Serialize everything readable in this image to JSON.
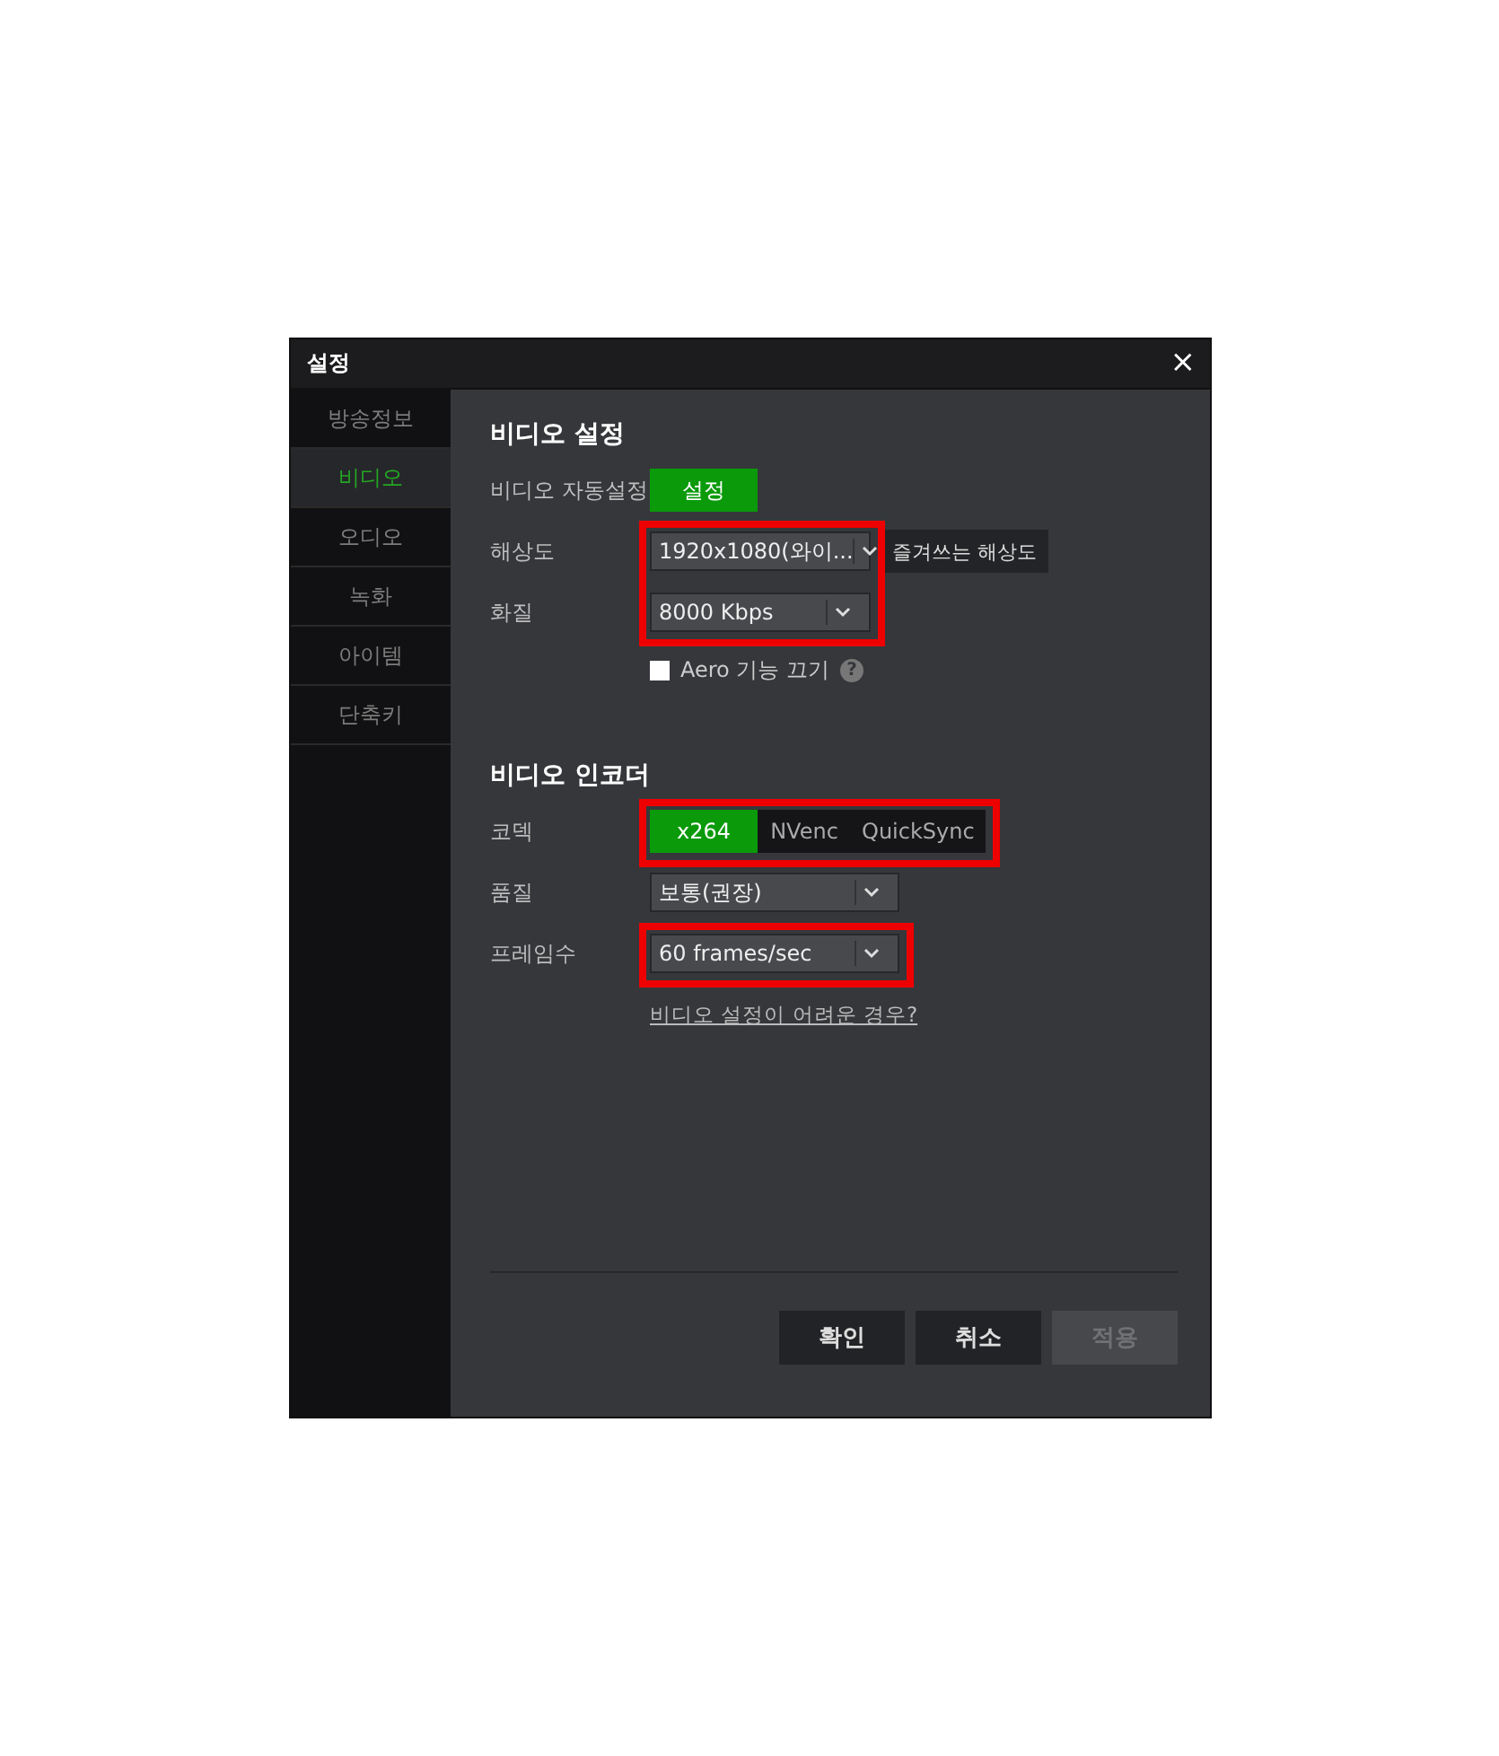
{
  "window": {
    "title": "설정",
    "close": "×"
  },
  "sidebar": {
    "items": [
      {
        "label": "방송정보",
        "selected": false
      },
      {
        "label": "비디오",
        "selected": true
      },
      {
        "label": "오디오",
        "selected": false
      },
      {
        "label": "녹화",
        "selected": false
      },
      {
        "label": "아이템",
        "selected": false
      },
      {
        "label": "단축키",
        "selected": false
      }
    ]
  },
  "sections": [
    {
      "title": "비디오 설정",
      "rows": [
        {
          "kind": "button",
          "label": "비디오 자동설정",
          "button": "설정",
          "highlighted": false
        },
        {
          "kind": "select",
          "label": "해상도",
          "value": "1920x1080(와이...",
          "extra_button": "즐겨쓰는 해상도",
          "wide": false,
          "highlighted": true
        },
        {
          "kind": "select",
          "label": "화질",
          "value": "8000 Kbps",
          "wide": false,
          "highlighted": true
        },
        {
          "kind": "checkbox",
          "label": "Aero 기능 끄기",
          "checked": false,
          "help": "?",
          "highlighted": false
        }
      ]
    },
    {
      "title": "비디오 인코더",
      "rows": [
        {
          "kind": "segmented",
          "label": "코덱",
          "options": [
            {
              "label": "x264",
              "selected": true
            },
            {
              "label": "NVenc",
              "selected": false
            },
            {
              "label": "QuickSync",
              "selected": false
            }
          ],
          "highlighted": true
        },
        {
          "kind": "select",
          "label": "품질",
          "value": "보통(권장)",
          "wide": true,
          "highlighted": false
        },
        {
          "kind": "select",
          "label": "프레임수",
          "value": "60 frames/sec",
          "wide": true,
          "highlighted": true
        },
        {
          "kind": "link",
          "label": "비디오 설정이 어려운 경우?",
          "highlighted": false
        }
      ]
    }
  ],
  "footer": {
    "buttons": [
      {
        "label": "확인",
        "disabled": false
      },
      {
        "label": "취소",
        "disabled": false
      },
      {
        "label": "적용",
        "disabled": true
      }
    ]
  }
}
